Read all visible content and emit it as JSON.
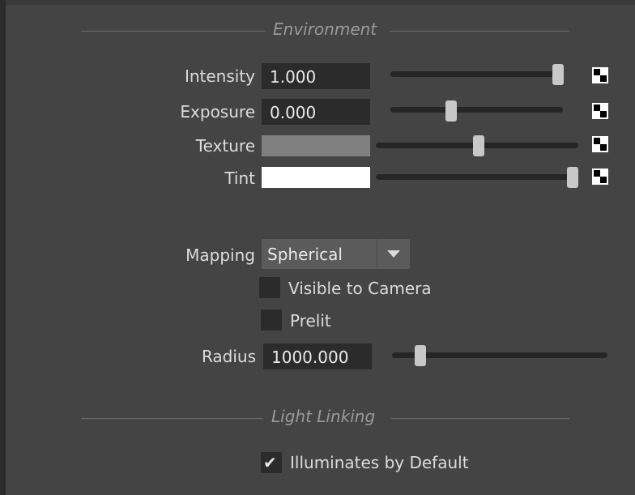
{
  "environment": {
    "title": "Environment",
    "intensity": {
      "label": "Intensity",
      "value": "1.000",
      "slider_fraction": 0.98
    },
    "exposure": {
      "label": "Exposure",
      "value": "0.000",
      "slider_fraction": 0.36
    },
    "texture": {
      "label": "Texture",
      "color": "#808080",
      "slider_fraction": 0.5
    },
    "tint": {
      "label": "Tint",
      "color": "#ffffff",
      "slider_fraction": 1.0
    },
    "mapping": {
      "label": "Mapping",
      "value": "Spherical"
    },
    "visible_to_camera": {
      "label": "Visible to Camera",
      "checked": false
    },
    "prelit": {
      "label": "Prelit",
      "checked": false
    },
    "radius": {
      "label": "Radius",
      "value": "1000.000",
      "slider_fraction": 0.13
    }
  },
  "light_linking": {
    "title": "Light Linking",
    "illuminates_by_default": {
      "label": "Illuminates by Default",
      "checked": true,
      "check_glyph": "✔"
    }
  },
  "icons": {
    "map_button": "checker-map-icon",
    "dropdown_arrow": "chevron-down-icon",
    "checkmark": "checkmark-icon"
  }
}
